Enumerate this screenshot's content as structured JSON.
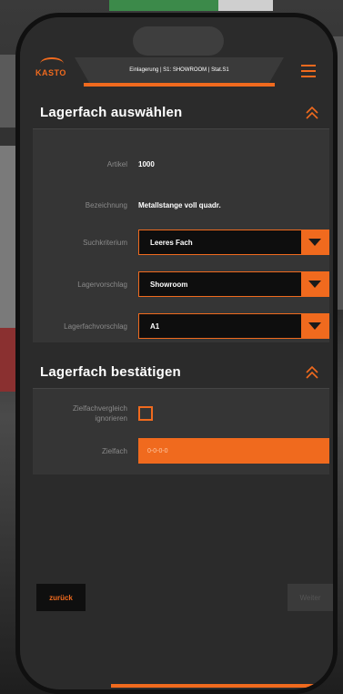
{
  "app": {
    "logo_text": "KASTO",
    "header_title": "Einlagerung | S1: SHOWROOM | Stat.S1"
  },
  "colors": {
    "accent": "#f06a1e",
    "panel": "#353535",
    "screen": "#2b2b2b"
  },
  "icons": {
    "menu": "hamburger-menu-icon",
    "collapse": "double-chevron-up-icon",
    "dropdown": "triangle-down-icon"
  },
  "section_select": {
    "title": "Lagerfach auswählen",
    "artikel_label": "Artikel",
    "artikel_value": "1000",
    "bezeichnung_label": "Bezeichnung",
    "bezeichnung_value": "Metallstange voll quadr.",
    "suchkriterium_label": "Suchkriterium",
    "suchkriterium_value": "Leeres Fach",
    "lagervorschlag_label": "Lagervorschlag",
    "lagervorschlag_value": "Showroom",
    "lagerfachvorschlag_label": "Lagerfachvorschlag",
    "lagerfachvorschlag_value": "A1"
  },
  "section_confirm": {
    "title": "Lagerfach bestätigen",
    "zielfachvergleich_label_1": "Zielfachvergleich",
    "zielfachvergleich_label_2": "ignorieren",
    "zielfach_label": "Zielfach",
    "zielfach_placeholder": "0-0-0-0"
  },
  "footer": {
    "back_label": "zurück",
    "next_label": "Weiter"
  }
}
